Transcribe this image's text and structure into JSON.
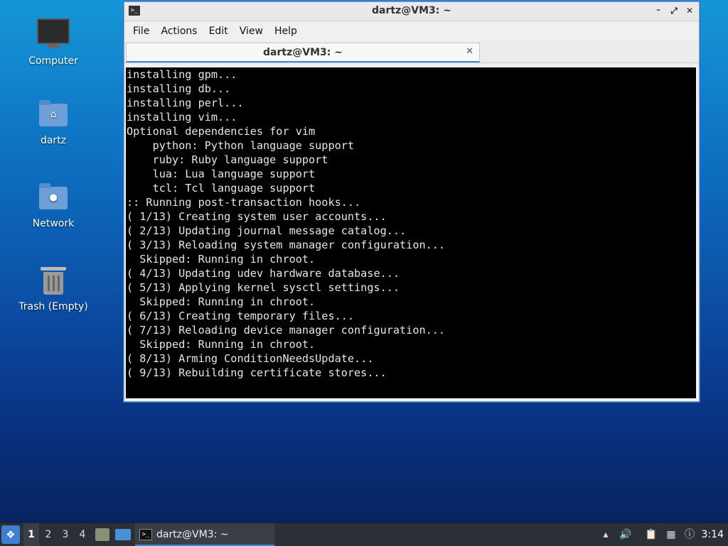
{
  "desktop": {
    "icons": [
      {
        "label": "Computer"
      },
      {
        "label": "dartz"
      },
      {
        "label": "Network"
      },
      {
        "label": "Trash (Empty)"
      }
    ]
  },
  "window": {
    "title": "dartz@VM3: ~",
    "controls": {
      "minimize": "ᵕ",
      "maximize": "⤢",
      "close": "✕"
    },
    "menu": [
      "File",
      "Actions",
      "Edit",
      "View",
      "Help"
    ],
    "tab": {
      "label": "dartz@VM3: ~",
      "close": "✕"
    },
    "terminal_lines": [
      "installing gpm...",
      "installing db...",
      "installing perl...",
      "installing vim...",
      "Optional dependencies for vim",
      "    python: Python language support",
      "    ruby: Ruby language support",
      "    lua: Lua language support",
      "    tcl: Tcl language support",
      ":: Running post-transaction hooks...",
      "( 1/13) Creating system user accounts...",
      "( 2/13) Updating journal message catalog...",
      "( 3/13) Reloading system manager configuration...",
      "  Skipped: Running in chroot.",
      "( 4/13) Updating udev hardware database...",
      "( 5/13) Applying kernel sysctl settings...",
      "  Skipped: Running in chroot.",
      "( 6/13) Creating temporary files...",
      "( 7/13) Reloading device manager configuration...",
      "  Skipped: Running in chroot.",
      "( 8/13) Arming ConditionNeedsUpdate...",
      "( 9/13) Rebuilding certificate stores..."
    ]
  },
  "taskbar": {
    "workspaces": [
      "1",
      "2",
      "3",
      "4"
    ],
    "active_workspace": "1",
    "task": {
      "label": "dartz@VM3: ~"
    },
    "clock": "3:14",
    "tray_icons": [
      "update-icon",
      "volume-icon",
      "clipboard-icon",
      "network-icon",
      "notification-icon",
      "display-icon"
    ]
  }
}
